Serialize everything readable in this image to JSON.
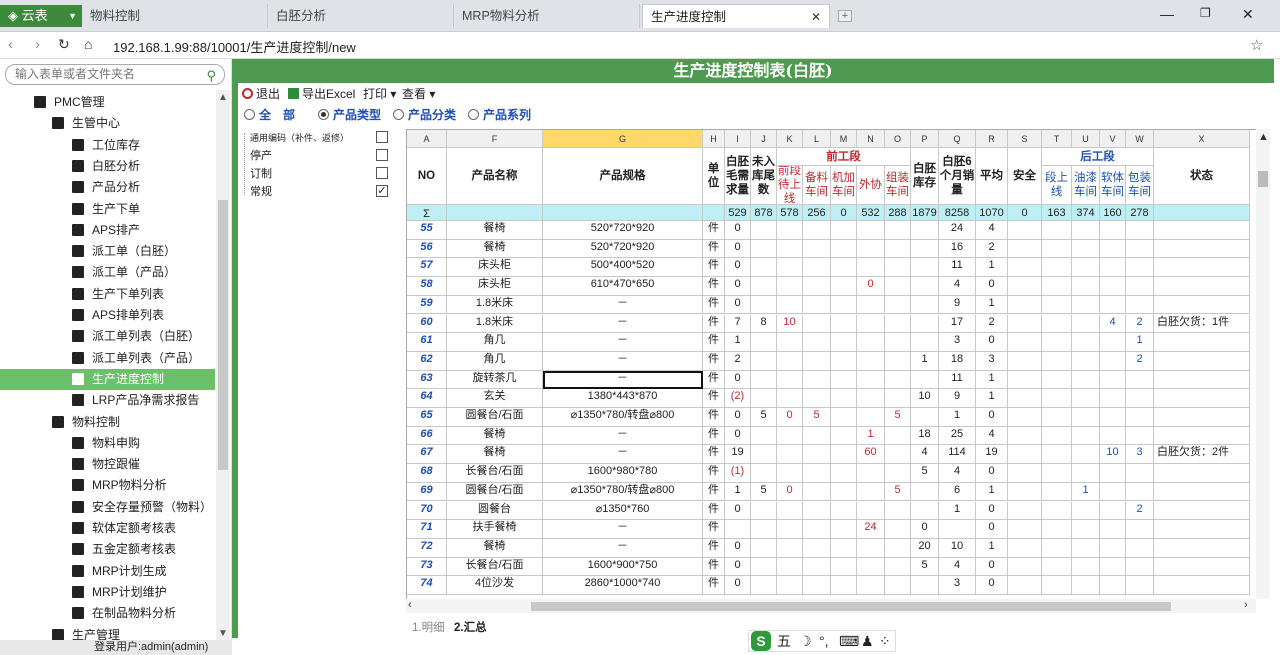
{
  "browser": {
    "brand": "云表",
    "tabs": [
      {
        "label": "物料控制"
      },
      {
        "label": "白胚分析"
      },
      {
        "label": "MRP物料分析"
      },
      {
        "label": "生产进度控制"
      }
    ],
    "url_prefix": "192.168.1.99:88/10001/",
    "url_rest": "生产进度控制/new"
  },
  "sidebar": {
    "search_placeholder": "输入表单或者文件夹名",
    "items": [
      {
        "label": "PMC管理",
        "icon": "folder-open-icon"
      },
      {
        "label": "生管中心",
        "icon": "grid-icon"
      },
      {
        "label": "工位库存",
        "icon": "database-icon"
      },
      {
        "label": "白胚分析",
        "icon": "cycle-icon"
      },
      {
        "label": "产品分析",
        "icon": "cycle-icon"
      },
      {
        "label": "生产下单",
        "icon": "doc-edit-icon"
      },
      {
        "label": "APS排产",
        "icon": "box-icon"
      },
      {
        "label": "派工单（白胚）",
        "icon": "sign-in-icon"
      },
      {
        "label": "派工单（产品）",
        "icon": "sign-in-icon"
      },
      {
        "label": "生产下单列表",
        "icon": "list-icon"
      },
      {
        "label": "APS排单列表",
        "icon": "list-icon"
      },
      {
        "label": "派工单列表（白胚）",
        "icon": "list-icon"
      },
      {
        "label": "派工单列表（产品）",
        "icon": "list-icon"
      },
      {
        "label": "生产进度控制",
        "icon": "refresh-icon"
      },
      {
        "label": "LRP产品净需求报告",
        "icon": "report-icon"
      },
      {
        "label": "物料控制",
        "icon": "sign-in-box-icon"
      },
      {
        "label": "物料申购",
        "icon": "doc-edit-icon"
      },
      {
        "label": "物控跟催",
        "icon": "share-icon"
      },
      {
        "label": "MRP物料分析",
        "icon": "qr-icon"
      },
      {
        "label": "安全存量预警（物料）",
        "icon": "list-icon"
      },
      {
        "label": "软体定额考核表",
        "icon": "table-icon"
      },
      {
        "label": "五金定额考核表",
        "icon": "table-icon"
      },
      {
        "label": "MRP计划生成",
        "icon": "gear-icon"
      },
      {
        "label": "MRP计划维护",
        "icon": "wrench-icon"
      },
      {
        "label": "在制品物料分析",
        "icon": "question-icon"
      },
      {
        "label": "生产管理",
        "icon": "gear-icon"
      }
    ],
    "status": "登录用户:admin(admin)"
  },
  "form": {
    "title": "生产进度控制表(白胚)",
    "toolbar": {
      "exit": "退出",
      "export": "导出Excel",
      "print": "打印",
      "view": "查看"
    },
    "filters": [
      {
        "label": "全　部",
        "checked": false
      },
      {
        "label": "产品类型",
        "checked": true
      },
      {
        "label": "产品分类",
        "checked": false
      },
      {
        "label": "产品系列",
        "checked": false
      }
    ],
    "tree": [
      {
        "label": "通用编码（补件、返修）",
        "checked": false
      },
      {
        "label": "停产",
        "checked": false
      },
      {
        "label": "订制",
        "checked": false
      },
      {
        "label": "常规",
        "checked": true
      }
    ],
    "bottom_tabs": [
      "1.明细",
      "2.汇总"
    ]
  },
  "grid": {
    "col_letters": [
      "A",
      "F",
      "G",
      "H",
      "I",
      "J",
      "K",
      "L",
      "M",
      "N",
      "O",
      "P",
      "Q",
      "R",
      "S",
      "T",
      "U",
      "V",
      "W",
      "X"
    ],
    "headers": {
      "no": "NO",
      "name": "产品名称",
      "spec": "产品规格",
      "unit": "单位",
      "gross": "白胚毛需求量",
      "tail": "未入库尾数",
      "front_group": "前工段",
      "front": [
        "前段待上线",
        "备料车间",
        "机加车间",
        "外协",
        "组装车间"
      ],
      "stock": "白胚库存",
      "sales6": "白胚6个月销量",
      "avg": "平均",
      "safe": "安全",
      "back_group": "后工段",
      "back": [
        "段上线",
        "油漆车间",
        "软体车间",
        "包装车间"
      ],
      "status": "状态"
    },
    "sum_label": "Σ",
    "sums": [
      "529",
      "878",
      "578",
      "256",
      "0",
      "532",
      "288",
      "1879",
      "8258",
      "1070",
      "0",
      "163",
      "374",
      "160",
      "278"
    ],
    "rows": [
      {
        "no": "55",
        "name": "餐椅",
        "spec": "520*720*920",
        "unit": "件",
        "vals": [
          "0",
          "",
          "",
          "",
          "",
          "",
          "",
          "",
          "24",
          "4",
          "",
          "",
          "",
          "",
          "",
          ""
        ]
      },
      {
        "no": "56",
        "name": "餐椅",
        "spec": "520*720*920",
        "unit": "件",
        "vals": [
          "0",
          "",
          "",
          "",
          "",
          "",
          "",
          "",
          "16",
          "2",
          "",
          "",
          "",
          "",
          "",
          ""
        ]
      },
      {
        "no": "57",
        "name": "床头柜",
        "spec": "500*400*520",
        "unit": "件",
        "vals": [
          "0",
          "",
          "",
          "",
          "",
          "",
          "",
          "",
          "11",
          "1",
          "",
          "",
          "",
          "",
          "",
          ""
        ]
      },
      {
        "no": "58",
        "name": "床头柜",
        "spec": "610*470*650",
        "unit": "件",
        "vals": [
          "0",
          "",
          "",
          "",
          "",
          "0",
          "",
          "",
          "4",
          "0",
          "",
          "",
          "",
          "",
          "",
          ""
        ]
      },
      {
        "no": "59",
        "name": "1.8米床",
        "spec": "－",
        "unit": "件",
        "vals": [
          "0",
          "",
          "",
          "",
          "",
          "",
          "",
          "",
          "9",
          "1",
          "",
          "",
          "",
          "",
          "",
          ""
        ]
      },
      {
        "no": "60",
        "name": "1.8米床",
        "spec": "－",
        "unit": "件",
        "vals": [
          "7",
          "8",
          "10",
          "",
          "",
          "",
          "",
          "",
          "17",
          "2",
          "",
          "",
          "",
          "4",
          "2",
          "白胚欠货：1件"
        ]
      },
      {
        "no": "61",
        "name": "角几",
        "spec": "－",
        "unit": "件",
        "vals": [
          "1",
          "",
          "",
          "",
          "",
          "",
          "",
          "",
          "3",
          "0",
          "",
          "",
          "",
          "",
          "1",
          ""
        ]
      },
      {
        "no": "62",
        "name": "角几",
        "spec": "－",
        "unit": "件",
        "vals": [
          "2",
          "",
          "",
          "",
          "",
          "",
          "",
          "1",
          "18",
          "3",
          "",
          "",
          "",
          "",
          "2",
          ""
        ]
      },
      {
        "no": "63",
        "name": "旋转茶几",
        "spec": "－",
        "unit": "件",
        "vals": [
          "0",
          "",
          "",
          "",
          "",
          "",
          "",
          "",
          "11",
          "1",
          "",
          "",
          "",
          "",
          "",
          ""
        ]
      },
      {
        "no": "64",
        "name": "玄关",
        "spec": "1380*443*870",
        "unit": "件",
        "vals": [
          "(2)",
          "",
          "",
          "",
          "",
          "",
          "",
          "10",
          "9",
          "1",
          "",
          "",
          "",
          "",
          "",
          ""
        ]
      },
      {
        "no": "65",
        "name": "圆餐台/石面",
        "spec": "⌀1350*780/转盘⌀800",
        "unit": "件",
        "vals": [
          "0",
          "5",
          "0",
          "5",
          "",
          "",
          "5",
          "",
          "1",
          "0",
          "",
          "",
          "",
          "",
          "",
          ""
        ]
      },
      {
        "no": "66",
        "name": "餐椅",
        "spec": "－",
        "unit": "件",
        "vals": [
          "0",
          "",
          "",
          "",
          "",
          "1",
          "",
          "18",
          "25",
          "4",
          "",
          "",
          "",
          "",
          "",
          ""
        ]
      },
      {
        "no": "67",
        "name": "餐椅",
        "spec": "－",
        "unit": "件",
        "vals": [
          "19",
          "",
          "",
          "",
          "",
          "60",
          "",
          "4",
          "114",
          "19",
          "",
          "",
          "",
          "10",
          "3",
          "白胚欠货：2件"
        ]
      },
      {
        "no": "68",
        "name": "长餐台/石面",
        "spec": "1600*980*780",
        "unit": "件",
        "vals": [
          "(1)",
          "",
          "",
          "",
          "",
          "",
          "",
          "5",
          "4",
          "0",
          "",
          "",
          "",
          "",
          "",
          ""
        ]
      },
      {
        "no": "69",
        "name": "圆餐台/石面",
        "spec": "⌀1350*780/转盘⌀800",
        "unit": "件",
        "vals": [
          "1",
          "5",
          "0",
          "",
          "",
          "",
          "5",
          "",
          "6",
          "1",
          "",
          "",
          "1",
          "",
          "",
          ""
        ]
      },
      {
        "no": "70",
        "name": "圆餐台",
        "spec": "⌀1350*760",
        "unit": "件",
        "vals": [
          "0",
          "",
          "",
          "",
          "",
          "",
          "",
          "",
          "1",
          "0",
          "",
          "",
          "",
          "",
          "2",
          ""
        ]
      },
      {
        "no": "71",
        "name": "扶手餐椅",
        "spec": "－",
        "unit": "件",
        "vals": [
          "",
          "",
          "",
          "",
          "",
          "24",
          "",
          "0",
          "",
          "0",
          "",
          "",
          "",
          "",
          "",
          ""
        ]
      },
      {
        "no": "72",
        "name": "餐椅",
        "spec": "－",
        "unit": "件",
        "vals": [
          "0",
          "",
          "",
          "",
          "",
          "",
          "",
          "20",
          "10",
          "1",
          "",
          "",
          "",
          "",
          "",
          ""
        ]
      },
      {
        "no": "73",
        "name": "长餐台/石面",
        "spec": "1600*900*750",
        "unit": "件",
        "vals": [
          "0",
          "",
          "",
          "",
          "",
          "",
          "",
          "5",
          "4",
          "0",
          "",
          "",
          "",
          "",
          "",
          ""
        ]
      },
      {
        "no": "74",
        "name": "4位沙发",
        "spec": "2860*1000*740",
        "unit": "件",
        "vals": [
          "0",
          "",
          "",
          "",
          "",
          "",
          "",
          "",
          "3",
          "0",
          "",
          "",
          "",
          "",
          "",
          ""
        ]
      }
    ]
  },
  "ime": {
    "label": "五"
  }
}
